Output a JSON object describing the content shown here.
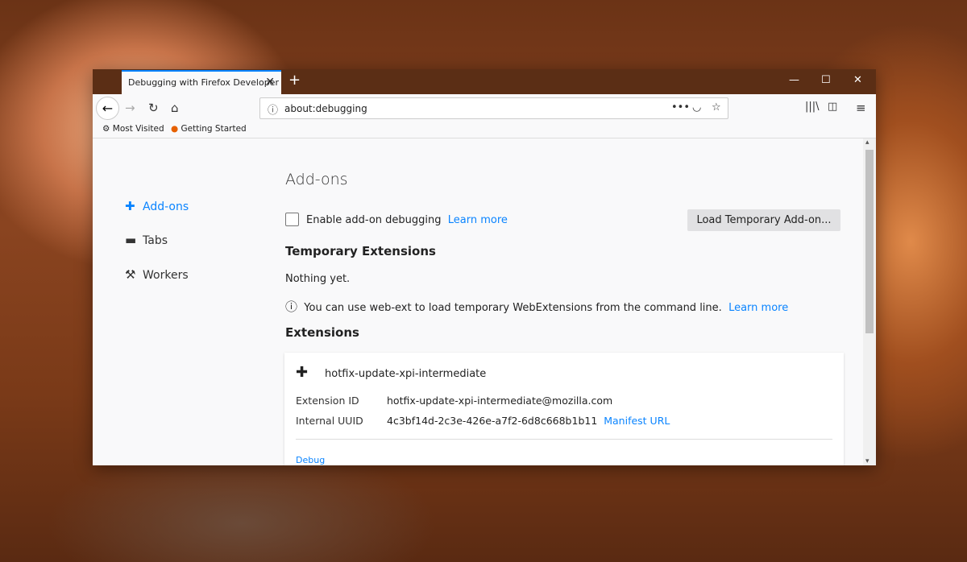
{
  "browser": {
    "tab_title": "Debugging with Firefox Developer",
    "url": "about:debugging",
    "bookmarks": [
      "Most Visited",
      "Getting Started"
    ]
  },
  "sidebar": {
    "items": [
      {
        "label": "Add-ons",
        "active": true
      },
      {
        "label": "Tabs"
      },
      {
        "label": "Workers"
      }
    ]
  },
  "main": {
    "title": "Add-ons",
    "enable_debugging": "Enable add-on debugging",
    "learn_more": "Learn more",
    "load_button": "Load Temporary Add-on...",
    "temp_heading": "Temporary Extensions",
    "nothing": "Nothing yet.",
    "hint": "You can use web-ext to load temporary WebExtensions from the command line.",
    "hint_link": "Learn more",
    "ext_heading": "Extensions",
    "extension": {
      "name": "hotfix-update-xpi-intermediate",
      "id_label": "Extension ID",
      "id": "hotfix-update-xpi-intermediate@mozilla.com",
      "uuid_label": "Internal UUID",
      "uuid": "4c3bf14d-2c3e-426e-a7f2-6d8c668b1b11",
      "manifest": "Manifest URL",
      "debug": "Debug"
    }
  },
  "colors": {
    "accent": "#0a84ff",
    "titlebar": "#5b2e15"
  }
}
